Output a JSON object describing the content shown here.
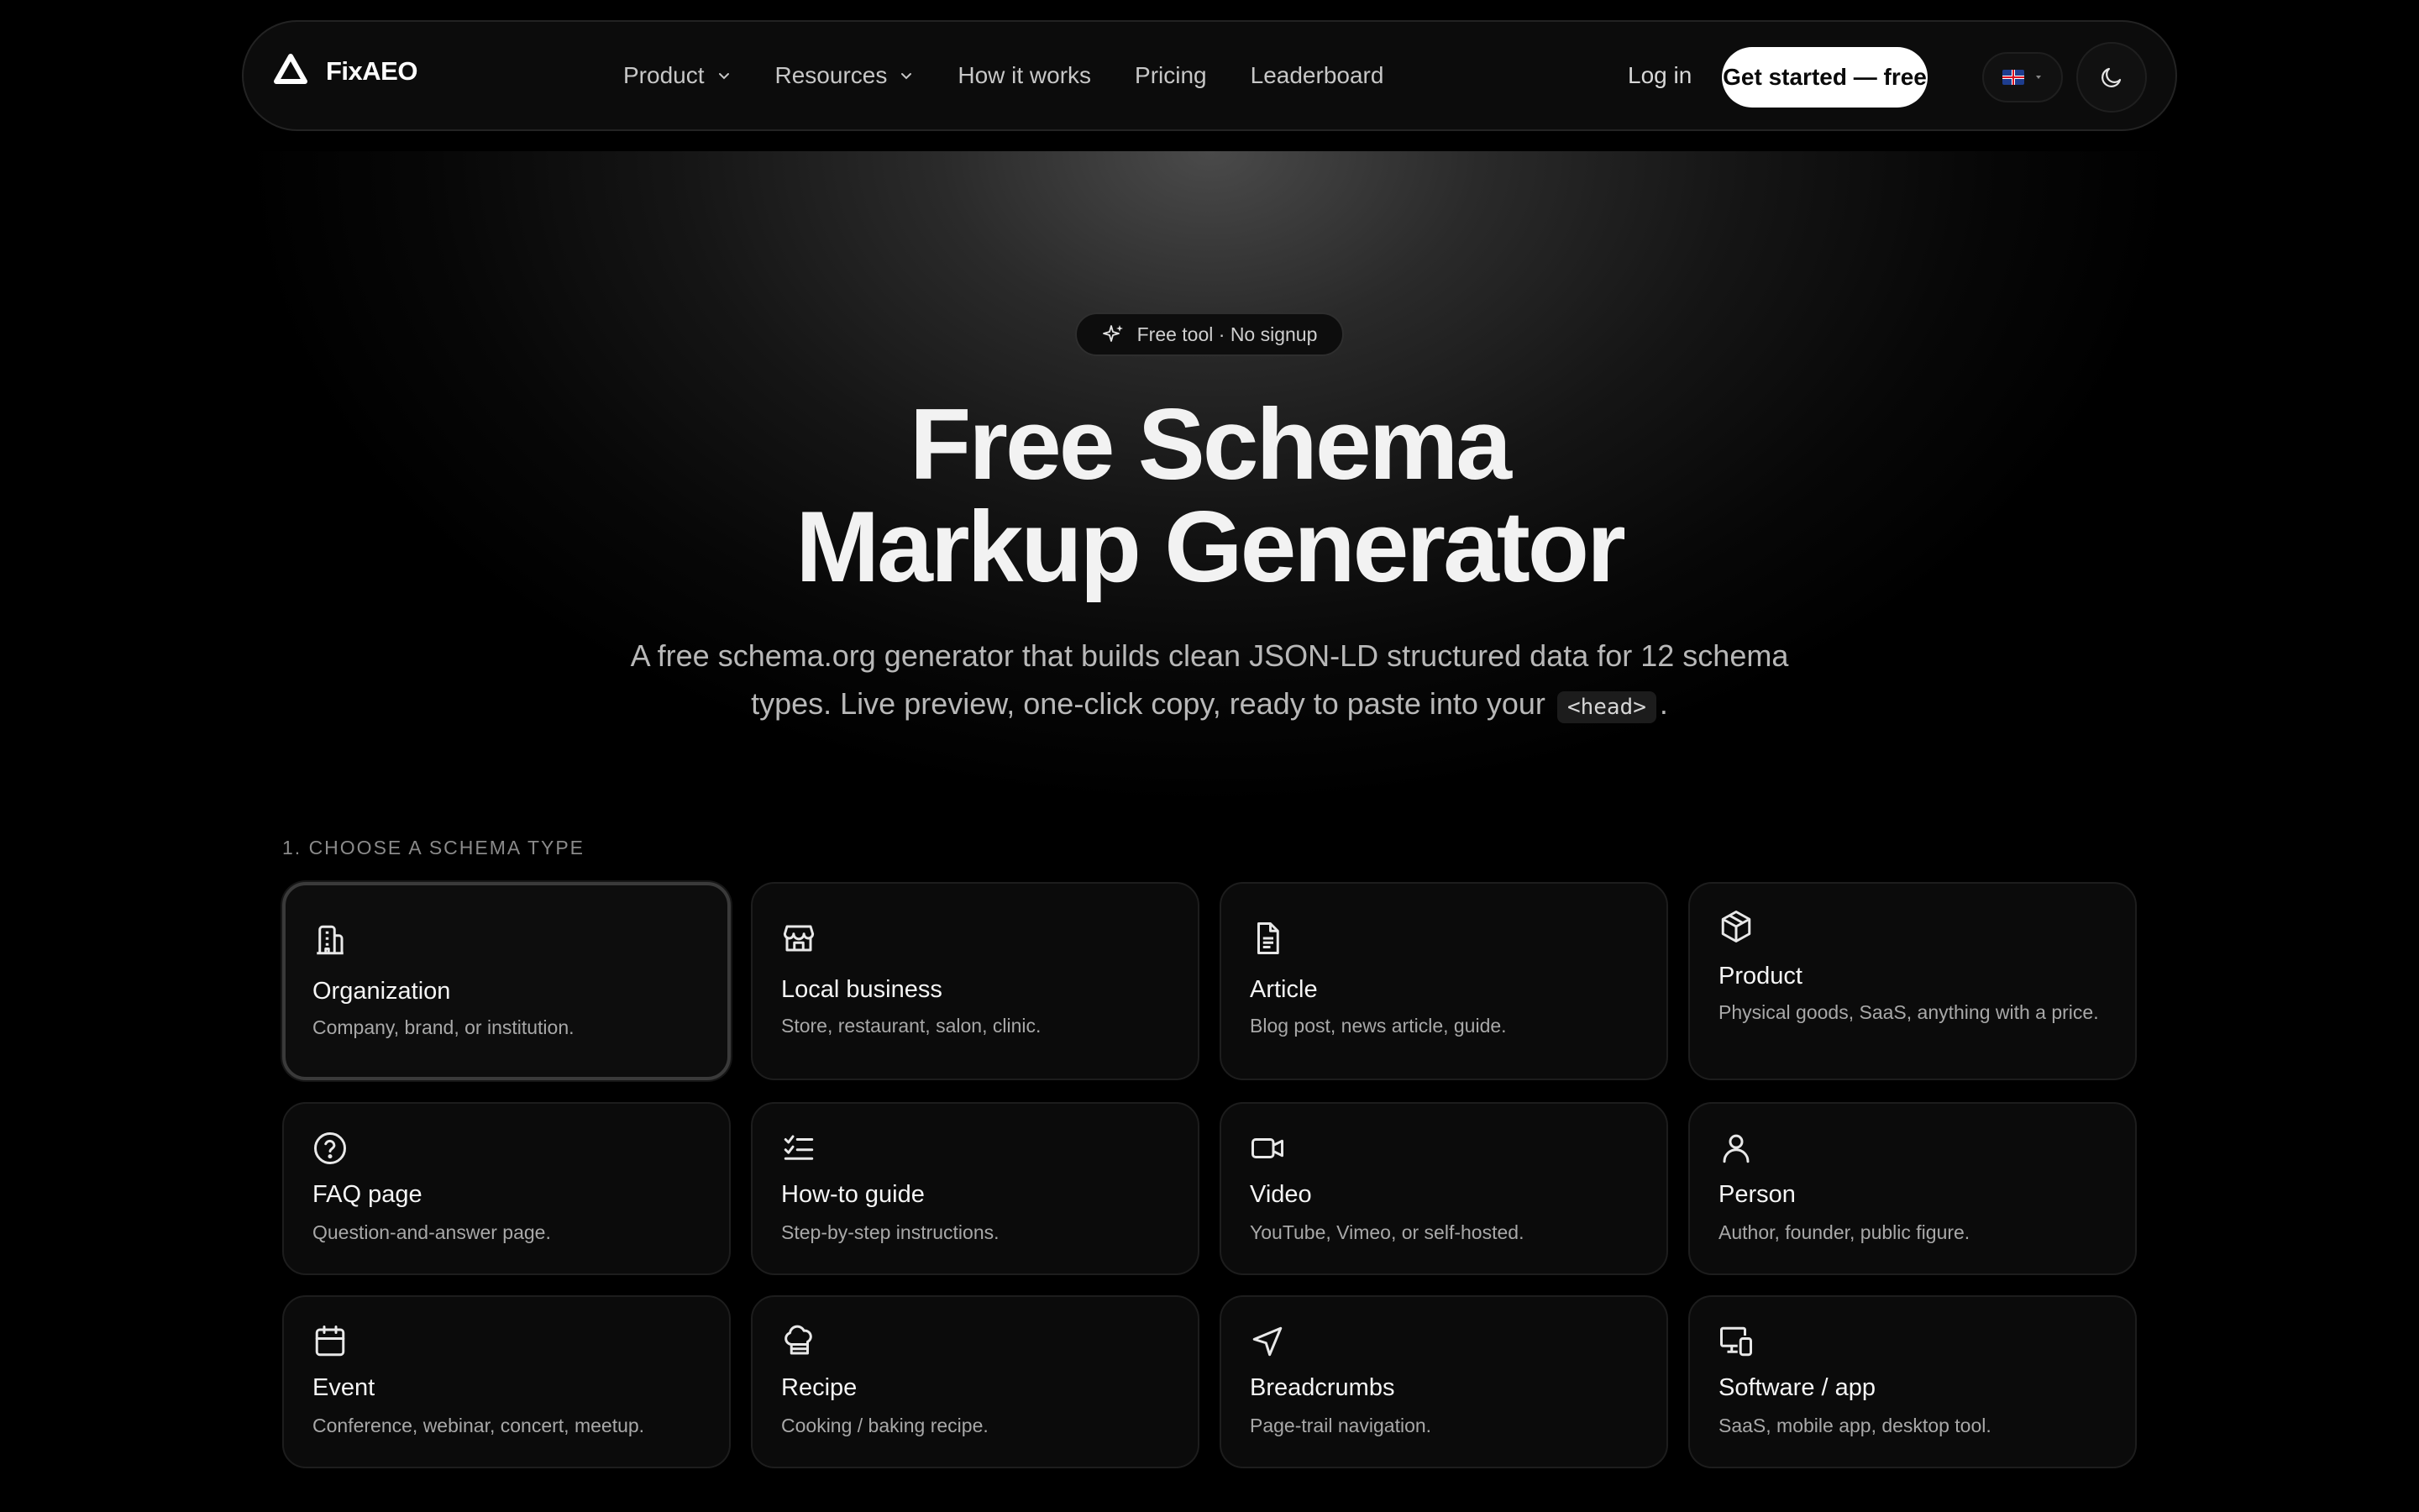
{
  "brand": {
    "name": "FixAEO"
  },
  "nav": {
    "items": [
      {
        "label": "Product",
        "has_dropdown": true
      },
      {
        "label": "Resources",
        "has_dropdown": true
      },
      {
        "label": "How it works",
        "has_dropdown": false
      },
      {
        "label": "Pricing",
        "has_dropdown": false
      },
      {
        "label": "Leaderboard",
        "has_dropdown": false
      }
    ],
    "login_label": "Log in",
    "cta_label": "Get started — free",
    "language_icon": "uk-flag-icon",
    "theme_icon": "moon-icon"
  },
  "hero": {
    "badge": "Free tool · No signup",
    "badge_icon": "sparkles-icon",
    "title_line1": "Free Schema",
    "title_line2": "Markup Generator",
    "subtitle_part1": "A free schema.org generator that builds clean JSON-LD structured data for 12 schema types. Live preview, one-click copy, ready to paste into your",
    "subtitle_code": "<head>",
    "subtitle_end": "."
  },
  "section": {
    "label": "1. CHOOSE A SCHEMA TYPE",
    "selected": "Organization",
    "cards": [
      {
        "title": "Organization",
        "description": "Company, brand, or institution.",
        "icon": "building-icon"
      },
      {
        "title": "Local business",
        "description": "Store, restaurant, salon, clinic.",
        "icon": "store-icon"
      },
      {
        "title": "Article",
        "description": "Blog post, news article, guide.",
        "icon": "document-icon"
      },
      {
        "title": "Product",
        "description": "Physical goods, SaaS, anything with a price.",
        "icon": "package-icon"
      },
      {
        "title": "FAQ page",
        "description": "Question-and-answer page.",
        "icon": "help-circle-icon"
      },
      {
        "title": "How-to guide",
        "description": "Step-by-step instructions.",
        "icon": "checklist-icon"
      },
      {
        "title": "Video",
        "description": "YouTube, Vimeo, or self-hosted.",
        "icon": "video-icon"
      },
      {
        "title": "Person",
        "description": "Author, founder, public figure.",
        "icon": "user-icon"
      },
      {
        "title": "Event",
        "description": "Conference, webinar, concert, meetup.",
        "icon": "calendar-icon"
      },
      {
        "title": "Recipe",
        "description": "Cooking / baking recipe.",
        "icon": "chef-hat-icon"
      },
      {
        "title": "Breadcrumbs",
        "description": "Page-trail navigation.",
        "icon": "navigation-icon"
      },
      {
        "title": "Software / app",
        "description": "SaaS, mobile app, desktop tool.",
        "icon": "devices-icon"
      }
    ]
  },
  "colors": {
    "background": "#000000",
    "card_background": "#0b0b0b",
    "card_border": "#1d1d1d",
    "text_primary": "#f5f5f5",
    "text_secondary": "#a8a8a8",
    "cta_background": "#ffffff"
  }
}
